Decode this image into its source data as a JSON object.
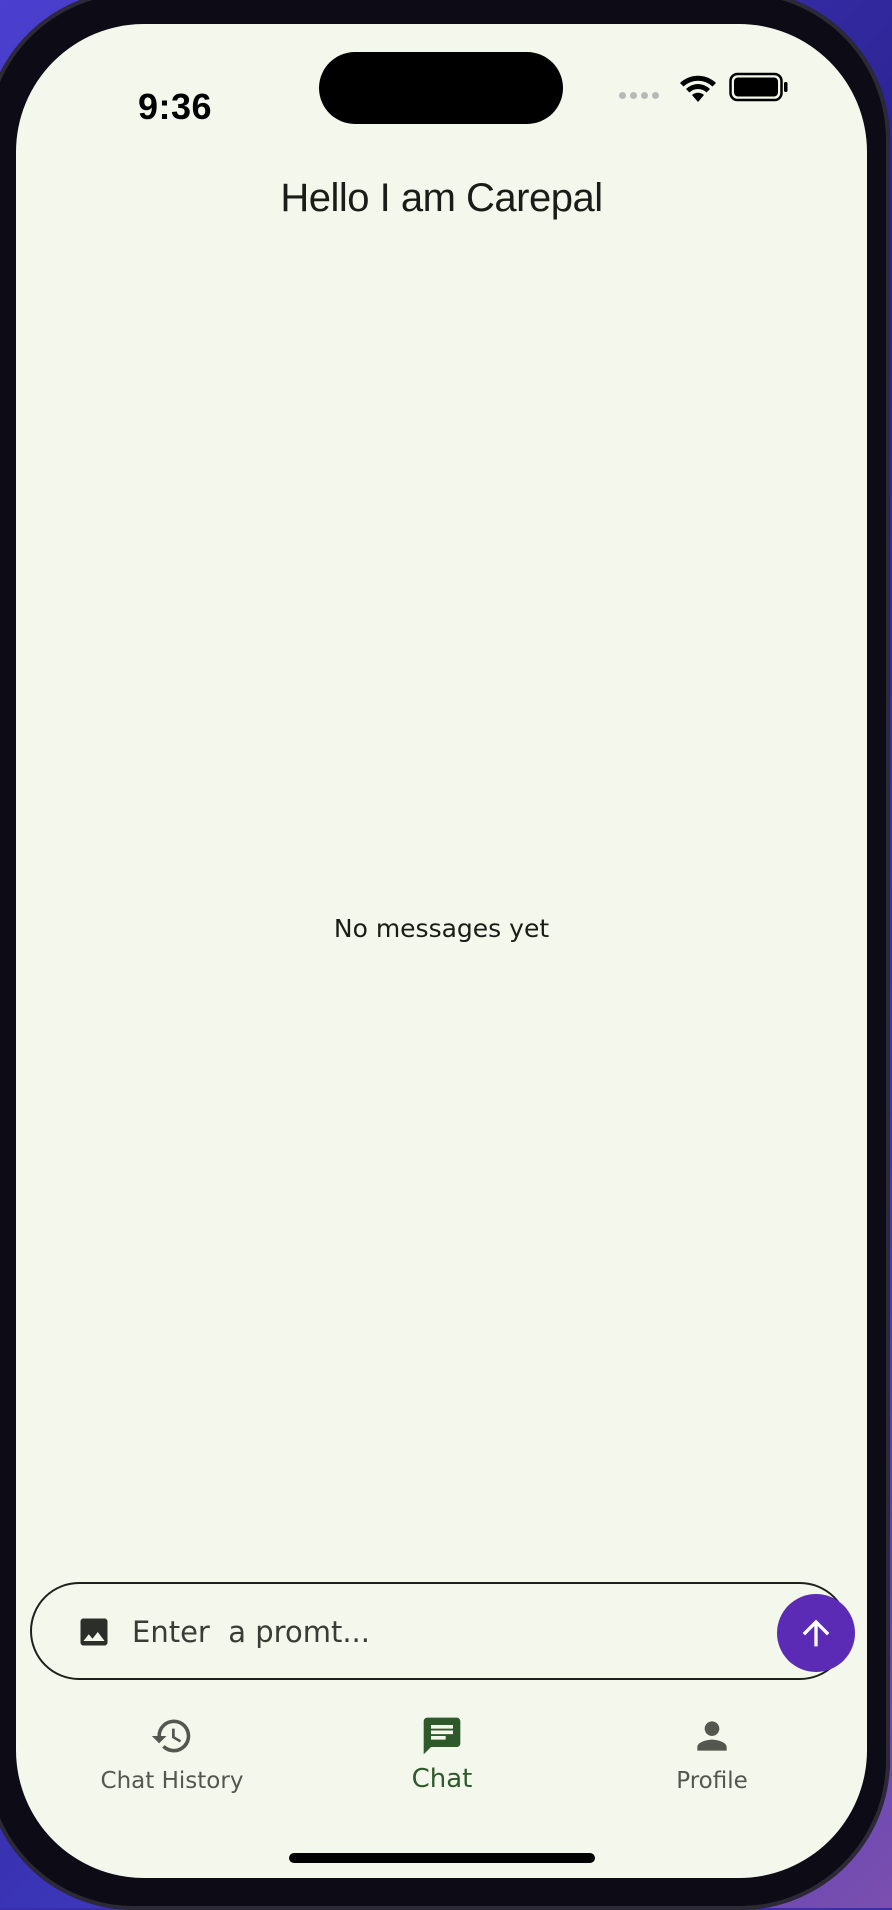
{
  "status_bar": {
    "time": "9:36"
  },
  "header": {
    "title": "Hello I am Carepal"
  },
  "chat": {
    "empty_message": "No messages yet"
  },
  "composer": {
    "placeholder": "Enter  a promt...",
    "value": "",
    "attach_icon": "image-icon",
    "send_icon": "arrow-up-icon"
  },
  "bottom_nav": {
    "items": [
      {
        "label": "Chat History",
        "icon": "history-icon",
        "active": false
      },
      {
        "label": "Chat",
        "icon": "chat-icon",
        "active": true
      },
      {
        "label": "Profile",
        "icon": "person-icon",
        "active": false
      }
    ]
  },
  "colors": {
    "background": "#f4f8ec",
    "accent": "#5c2bb6",
    "active_nav": "#2e5a2b",
    "inactive_nav": "#545650"
  }
}
